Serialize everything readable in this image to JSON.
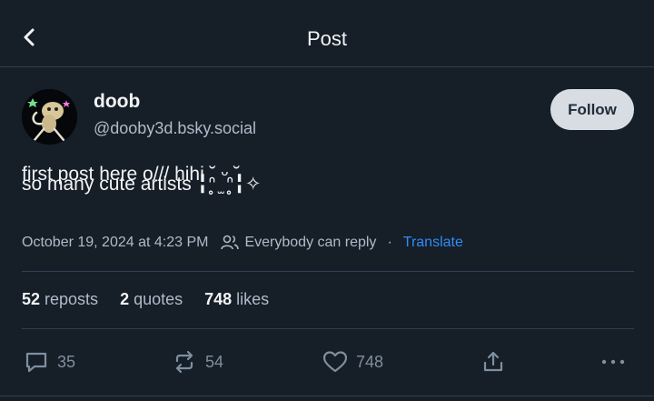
{
  "header": {
    "title": "Post"
  },
  "author": {
    "display_name": "doob",
    "handle": "@dooby3d.bsky.social"
  },
  "follow_label": "Follow",
  "post": {
    "text_line1": "first post here o/// hihi ˘ ᵕ ˘",
    "text_line2": "so many cute artists ╏ᐢ̥ ̫ ᐢ̥╏✧"
  },
  "meta": {
    "timestamp": "October 19, 2024 at 4:23 PM",
    "reply_setting": "Everybody can reply",
    "separator": "·",
    "translate_label": "Translate"
  },
  "stats": {
    "reposts_count": "52",
    "reposts_label": "reposts",
    "quotes_count": "2",
    "quotes_label": "quotes",
    "likes_count": "748",
    "likes_label": "likes"
  },
  "actions": {
    "reply_count": "35",
    "repost_count": "54",
    "like_count": "748"
  },
  "colors": {
    "background": "#161e27",
    "accent_link": "#2f8cf5",
    "muted_text": "#aebbc9",
    "follow_button_bg": "#d7dde3"
  }
}
